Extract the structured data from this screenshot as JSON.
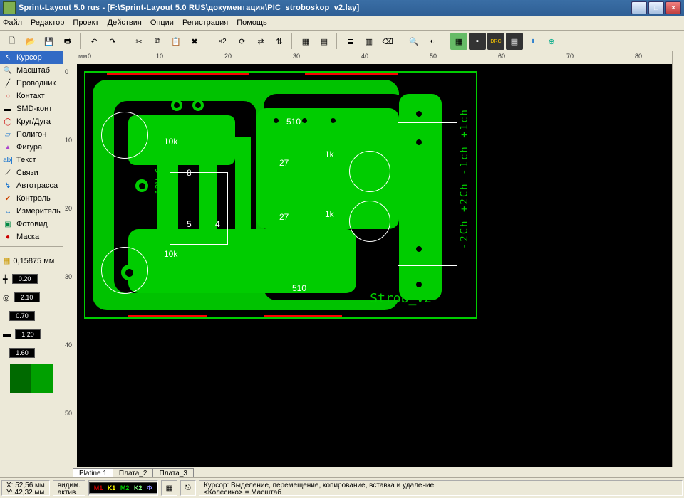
{
  "window": {
    "title": "Sprint-Layout 5.0 rus  - [F:\\Sprint-Layout 5.0 RUS\\документация\\PIC_stroboskop_v2.lay]"
  },
  "menu": [
    "Файл",
    "Редактор",
    "Проект",
    "Действия",
    "Опции",
    "Регистрация",
    "Помощь"
  ],
  "ruler": {
    "unit": "мм",
    "h_ticks": [
      "0",
      "10",
      "20",
      "30",
      "40",
      "50",
      "60",
      "70",
      "80"
    ],
    "v_ticks": [
      "0",
      "10",
      "20",
      "30",
      "40",
      "50"
    ]
  },
  "tools": {
    "items": [
      {
        "label": "Курсор",
        "icon": "↖",
        "selected": true
      },
      {
        "label": "Масштаб",
        "icon": "🔍"
      },
      {
        "label": "Проводник",
        "icon": "╱"
      },
      {
        "label": "Контакт",
        "icon": "○"
      },
      {
        "label": "SMD-конт",
        "icon": "▬"
      },
      {
        "label": "Круг/Дуга",
        "icon": "◯"
      },
      {
        "label": "Полигон",
        "icon": "▱"
      },
      {
        "label": "Фигура",
        "icon": "▲"
      },
      {
        "label": "Текст",
        "icon": "ab|"
      },
      {
        "label": "Связи",
        "icon": "⟋"
      },
      {
        "label": "Автотрасса",
        "icon": "↯"
      },
      {
        "label": "Контроль",
        "icon": "✔"
      },
      {
        "label": "Измеритель",
        "icon": "↔"
      },
      {
        "label": "Фотовид",
        "icon": "▣"
      },
      {
        "label": "Маска",
        "icon": "●"
      }
    ],
    "grid": "0,15875 мм",
    "nums": [
      "0.20",
      "2.10",
      "0.70",
      "1.20",
      "1.60"
    ]
  },
  "pcb": {
    "labels": [
      "10k",
      "10k",
      "510",
      "510",
      "27",
      "27",
      "1k",
      "1k",
      "5",
      "8",
      "4"
    ],
    "name": "Strob_v2",
    "side_text": "-2Ch  +2Ch  -1ch  +1ch",
    "vtext": "+12V  Gnd"
  },
  "tabs": [
    "Platine 1",
    "Плата_2",
    "Плата_3"
  ],
  "status": {
    "x": "X: 52,56 мм",
    "y": "Y: 42,32 мм",
    "vis": "видим.",
    "act": "актив.",
    "layers": {
      "m1": "M1",
      "k1": "K1",
      "m2": "M2",
      "k2": "K2",
      "f": "Ф"
    },
    "hint1": "Курсор: Выделение, перемещение, копирование, вставка и удаление.",
    "hint2": "<Колесико> = Масштаб"
  }
}
